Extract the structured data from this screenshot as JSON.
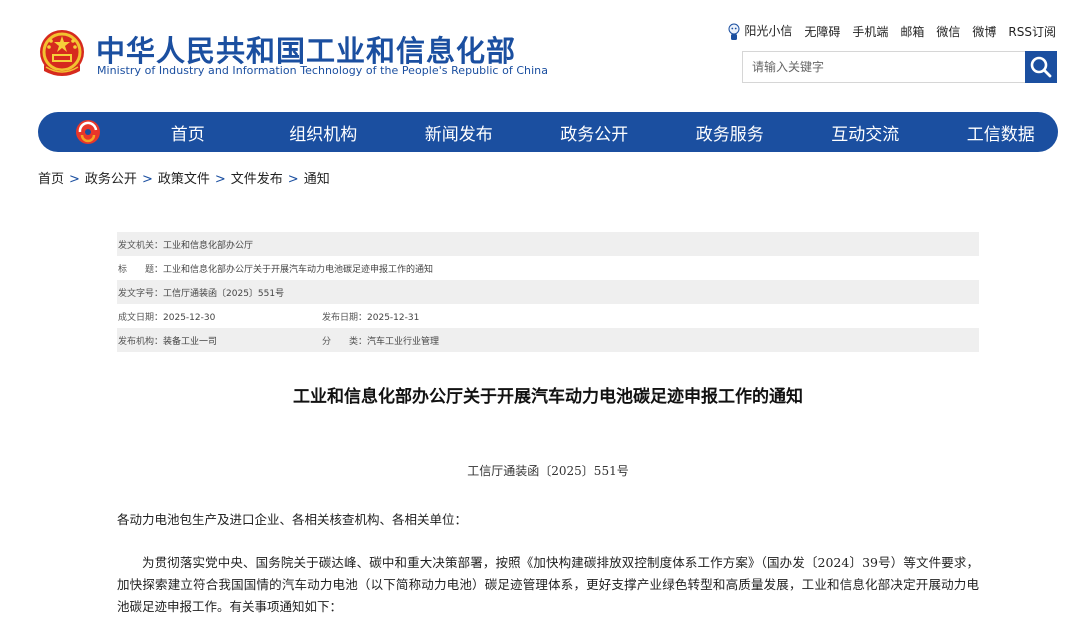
{
  "header": {
    "title": "中华人民共和国工业和信息化部",
    "subtitle": "Ministry of Industry and Information Technology of the People's Republic of China",
    "brand_color": "#1b4fa0",
    "emblem_icon": "national-emblem-icon"
  },
  "toplinks": [
    "阳光小信",
    "无障碍",
    "手机端",
    "邮箱",
    "微信",
    "微博",
    "RSS订阅"
  ],
  "search": {
    "placeholder": "请输入关键字",
    "icon": "search-icon"
  },
  "nav": {
    "items": [
      "首页",
      "组织机构",
      "新闻发布",
      "政务公开",
      "政务服务",
      "互动交流",
      "工信数据"
    ]
  },
  "breadcrumb": [
    "首页",
    "政务公开",
    "政策文件",
    "文件发布",
    "通知"
  ],
  "meta": {
    "issuer_label": "发文机关：",
    "issuer": "工业和信息化部办公厅",
    "title_label": "标　　题：",
    "title": "工业和信息化部办公厅关于开展汽车动力电池碳足迹申报工作的通知",
    "docno_label": "发文字号：",
    "docno": "工信厅通装函〔2025〕551号",
    "created_label": "成文日期：",
    "created": "2025-12-30",
    "published_label": "发布日期：",
    "published": "2025-12-31",
    "org_label": "发布机构：",
    "org": "装备工业一司",
    "category_label": "分　　类：",
    "category": "汽车工业行业管理"
  },
  "article": {
    "title": "工业和信息化部办公厅关于开展汽车动力电池碳足迹申报工作的通知",
    "doc_number": "工信厅通装函〔2025〕551号",
    "salutation": "各动力电池包生产及进口企业、各相关核查机构、各相关单位：",
    "paragraph": "为贯彻落实党中央、国务院关于碳达峰、碳中和重大决策部署，按照《加快构建碳排放双控制度体系工作方案》（国办发〔2024〕39号）等文件要求，加快探索建立符合我国国情的汽车动力电池（以下简称动力电池）碳足迹管理体系，更好支撑产业绿色转型和高质量发展，工业和信息化部决定开展动力电池碳足迹申报工作。有关事项通知如下："
  }
}
